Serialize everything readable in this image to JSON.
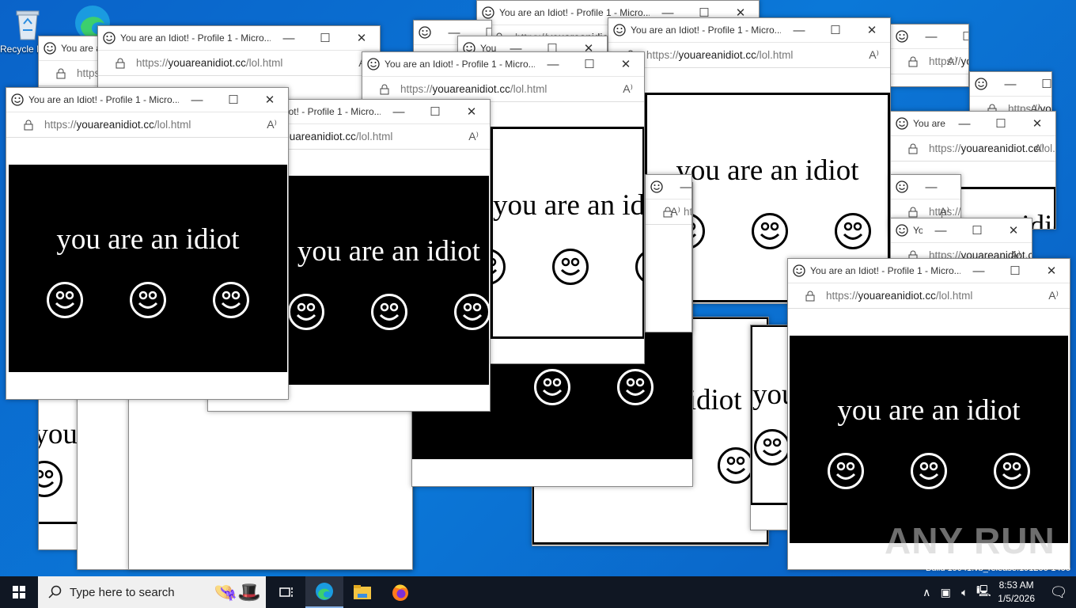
{
  "desktop": {
    "icons": [
      {
        "label": "Recycle Bin",
        "icon": "recycle-bin-icon"
      },
      {
        "label": "Microsoft Edge",
        "icon": "edge-icon"
      }
    ],
    "build_text": "Build 19041.vb_release.191206-1406",
    "watermark": "ANY RUN"
  },
  "popup": {
    "title": "You are an Idiot! - Profile 1 - Micro...",
    "url_prefix": "https://",
    "url_domain": "youareanidiot.cc",
    "url_path": "/lol.html",
    "read_aloud": "A⁾",
    "minimize": "—",
    "maximize": "☐",
    "close": "✕",
    "message": "you are an idiot"
  },
  "taskbar": {
    "search_placeholder": "Type here to search",
    "time": "8:53 AM",
    "date": "1/5/2026",
    "tray_chevron": "∧",
    "apps": [
      "task-view",
      "edge",
      "file-explorer",
      "firefox"
    ]
  },
  "colors": {
    "desktop": "#0a6ccf",
    "taskbar": "#101723",
    "panel_dark": "#000000"
  }
}
